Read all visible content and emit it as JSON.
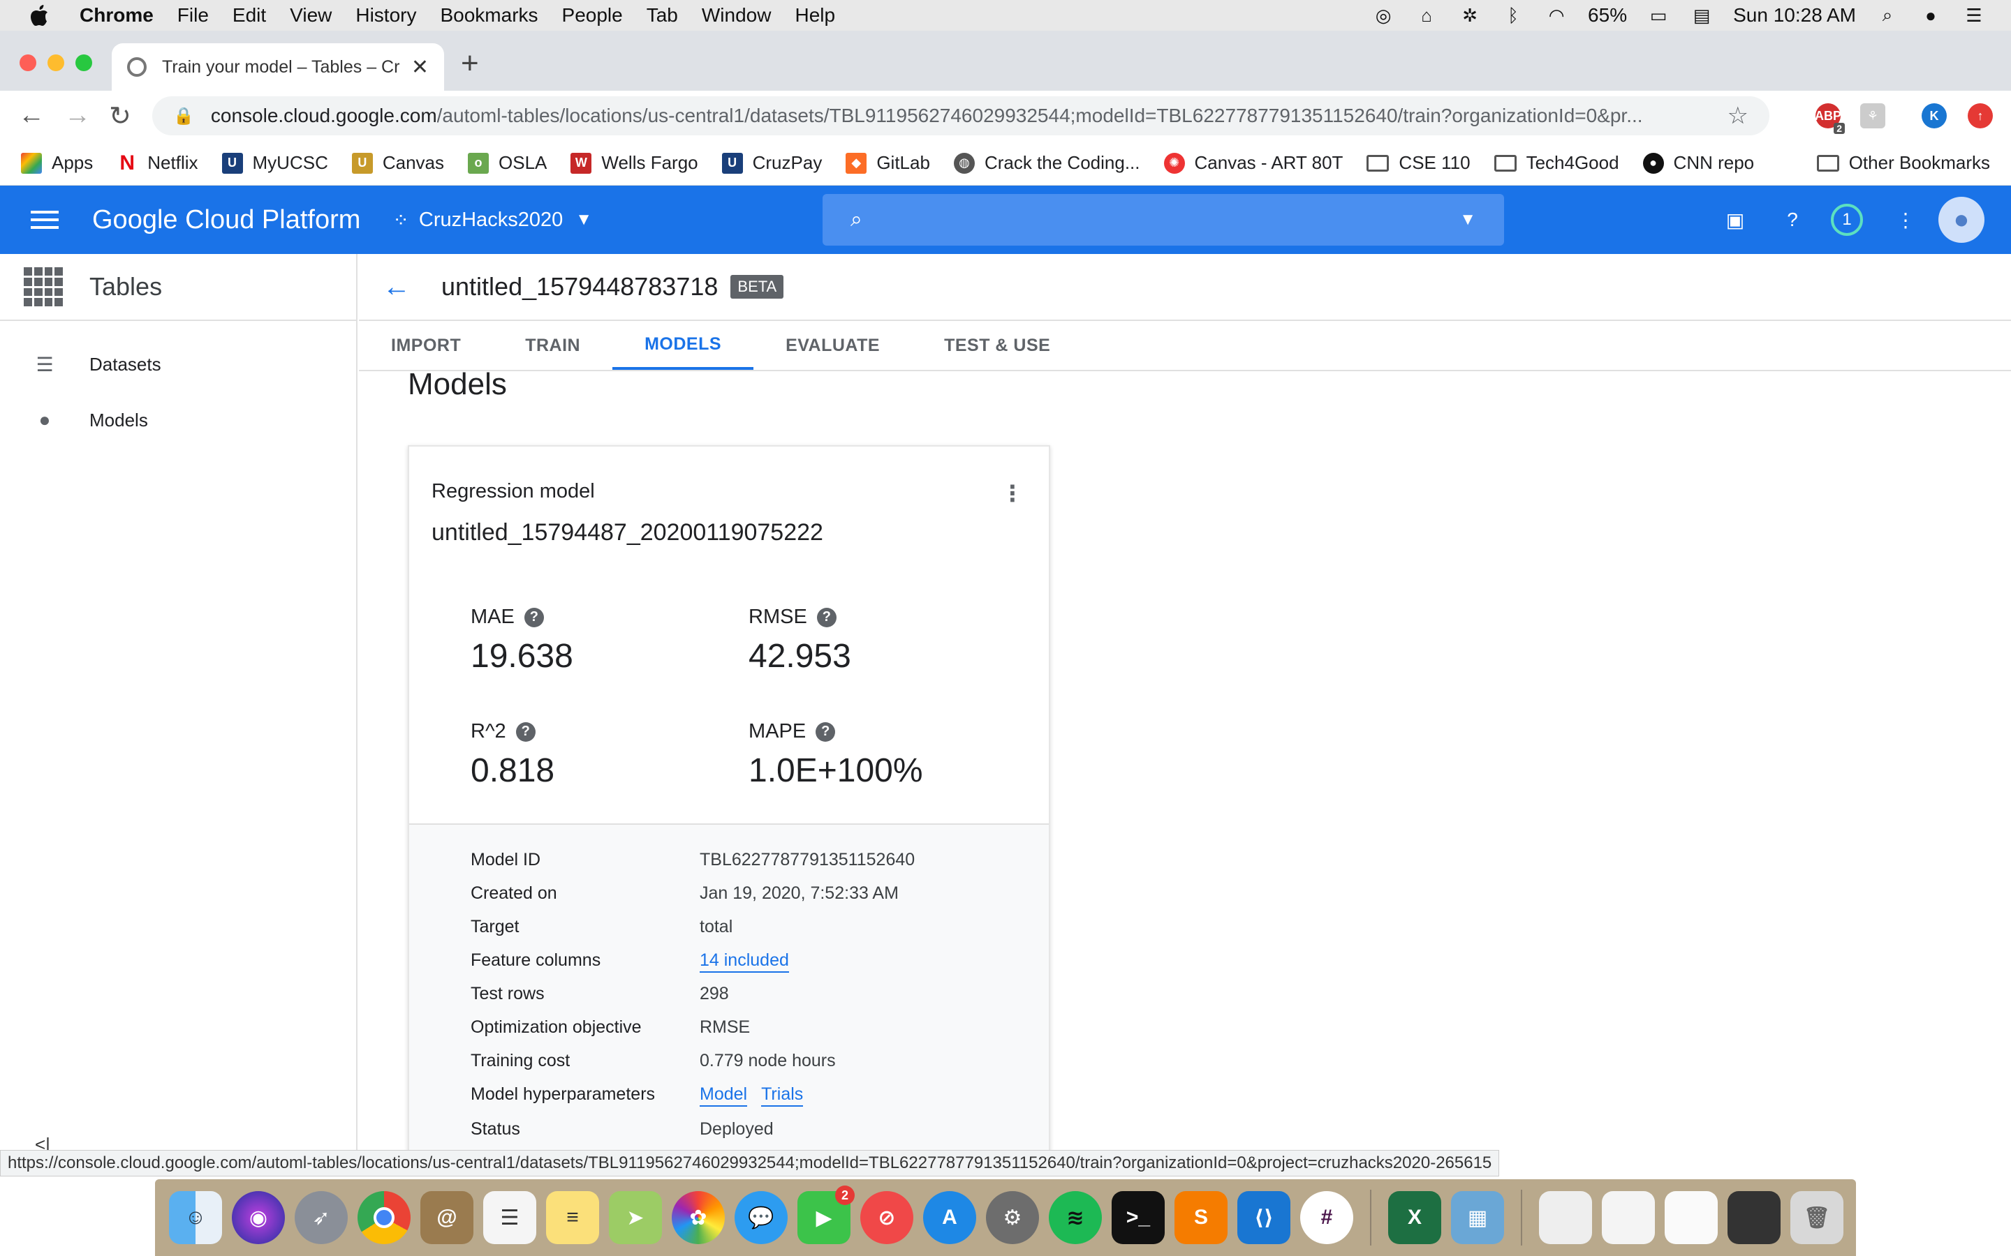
{
  "menubar": {
    "app": "Chrome",
    "items": [
      "File",
      "Edit",
      "View",
      "History",
      "Bookmarks",
      "People",
      "Tab",
      "Window",
      "Help"
    ],
    "battery": "65%",
    "clock": "Sun 10:28 AM"
  },
  "tab": {
    "title": "Train your model – Tables – Cr",
    "close": "✕",
    "new": "+"
  },
  "toolbar": {
    "url_host": "console.cloud.google.com",
    "url_path": "/automl-tables/locations/us-central1/datasets/TBL9119562746029932544;modelId=TBL6227787791351152640/train?organizationId=0&pr...",
    "ext_abp_badge": "2",
    "profile_letter": "K"
  },
  "bookmarks": {
    "items": [
      "Apps",
      "Netflix",
      "MyUCSC",
      "Canvas",
      "OSLA",
      "Wells Fargo",
      "CruzPay",
      "GitLab",
      "Crack the Coding...",
      "Canvas - ART 80T",
      "CSE 110",
      "Tech4Good",
      "CNN repo"
    ],
    "other": "Other Bookmarks"
  },
  "gcp": {
    "brand": "Google Cloud Platform",
    "project": "CruzHacks2020",
    "notifications": "1"
  },
  "sidebar": {
    "product": "Tables",
    "items": [
      {
        "label": "Datasets",
        "icon": "list-icon"
      },
      {
        "label": "Models",
        "icon": "lightbulb-icon"
      }
    ],
    "collapse": "<|"
  },
  "main": {
    "title": "untitled_1579448783718",
    "beta": "BETA",
    "tabs": [
      "IMPORT",
      "TRAIN",
      "MODELS",
      "EVALUATE",
      "TEST & USE"
    ],
    "active_tab": "MODELS",
    "heading": "Models"
  },
  "card": {
    "type": "Regression model",
    "name": "untitled_15794487_20200119075222",
    "metrics": [
      {
        "label": "MAE",
        "value": "19.638"
      },
      {
        "label": "RMSE",
        "value": "42.953"
      },
      {
        "label": "R^2",
        "value": "0.818"
      },
      {
        "label": "MAPE",
        "value": "1.0E+100%"
      }
    ],
    "details": {
      "model_id_label": "Model ID",
      "model_id": "TBL6227787791351152640",
      "created_label": "Created on",
      "created": "Jan 19, 2020, 7:52:33 AM",
      "target_label": "Target",
      "target": "total",
      "features_label": "Feature columns",
      "features": "14 included",
      "test_rows_label": "Test rows",
      "test_rows": "298",
      "objective_label": "Optimization objective",
      "objective": "RMSE",
      "cost_label": "Training cost",
      "cost": "0.779 node hours",
      "hyper_label": "Model hyperparameters",
      "hyper_model": "Model",
      "hyper_trials": "Trials",
      "status_label": "Status",
      "status": "Deployed"
    }
  },
  "statusbar": {
    "url": "https://console.cloud.google.com/automl-tables/locations/us-central1/datasets/TBL9119562746029932544;modelId=TBL6227787791351152640/train?organizationId=0&project=cruzhacks2020-265615"
  },
  "dock": {
    "facetime_badge": "2"
  }
}
